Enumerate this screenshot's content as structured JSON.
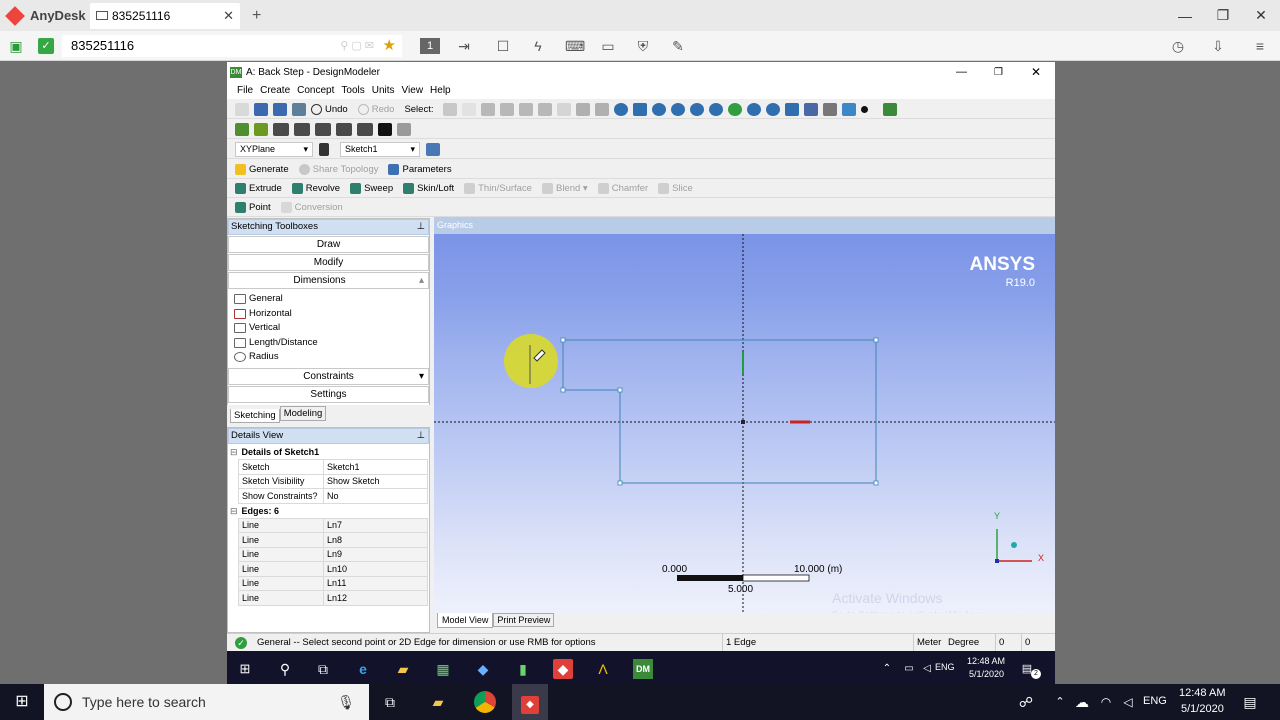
{
  "anydesk": {
    "app_name": "AnyDesk",
    "tab_label": "835251116",
    "address": "835251116",
    "colors": {
      "brand": "#ef443b"
    }
  },
  "dm": {
    "title": "A: Back Step - DesignModeler",
    "menu": [
      "File",
      "Create",
      "Concept",
      "Tools",
      "Units",
      "View",
      "Help"
    ],
    "toolbar1": {
      "undo": "Undo",
      "redo": "Redo",
      "select": "Select:"
    },
    "plane_select": "XYPlane",
    "sketch_select": "Sketch1",
    "toolbar4": {
      "generate": "Generate",
      "share_topology": "Share Topology",
      "parameters": "Parameters"
    },
    "toolbar5": {
      "extrude": "Extrude",
      "revolve": "Revolve",
      "sweep": "Sweep",
      "skin": "Skin/Loft",
      "thin": "Thin/Surface",
      "blend": "Blend",
      "chamfer": "Chamfer",
      "slice": "Slice"
    },
    "toolbar6": {
      "point": "Point",
      "conversion": "Conversion"
    },
    "sketching_toolboxes": {
      "header": "Sketching Toolboxes",
      "draw": "Draw",
      "modify": "Modify",
      "dimensions": "Dimensions",
      "dim_items": [
        "General",
        "Horizontal",
        "Vertical",
        "Length/Distance",
        "Radius"
      ],
      "constraints": "Constraints",
      "settings": "Settings",
      "tab_sketching": "Sketching",
      "tab_modeling": "Modeling"
    },
    "details": {
      "header": "Details View",
      "title": "Details of Sketch1",
      "rows": [
        {
          "k": "Sketch",
          "v": "Sketch1"
        },
        {
          "k": "Sketch Visibility",
          "v": "Show Sketch"
        },
        {
          "k": "Show Constraints?",
          "v": "No"
        }
      ],
      "edges_title": "Edges: 6",
      "edges": [
        {
          "k": "Line",
          "v": "Ln7"
        },
        {
          "k": "Line",
          "v": "Ln8"
        },
        {
          "k": "Line",
          "v": "Ln9"
        },
        {
          "k": "Line",
          "v": "Ln10"
        },
        {
          "k": "Line",
          "v": "Ln11"
        },
        {
          "k": "Line",
          "v": "Ln12"
        }
      ]
    },
    "graphics": {
      "header": "Graphics",
      "brand": "ANSYS",
      "version": "R19.0",
      "scale_left": "0.000",
      "scale_right": "10.000 (m)",
      "scale_mid": "5.000",
      "tab_model": "Model View",
      "tab_print": "Print Preview",
      "watermark_1": "Activate Windows",
      "watermark_2": "Go to Settings to activate Windows.",
      "axis_x": "X",
      "axis_y": "Y"
    },
    "status": {
      "message": "General -- Select second point or 2D Edge for dimension or use RMB for options",
      "selection": "1 Edge",
      "unit_length": "Meter",
      "unit_angle": "Degree",
      "v1": "0",
      "v2": "0"
    }
  },
  "remote_taskbar": {
    "lang": "ENG",
    "time": "12:48 AM",
    "date": "5/1/2020",
    "badge": "2"
  },
  "local_taskbar": {
    "search_placeholder": "Type here to search",
    "lang": "ENG",
    "time": "12:48 AM",
    "date": "5/1/2020"
  }
}
